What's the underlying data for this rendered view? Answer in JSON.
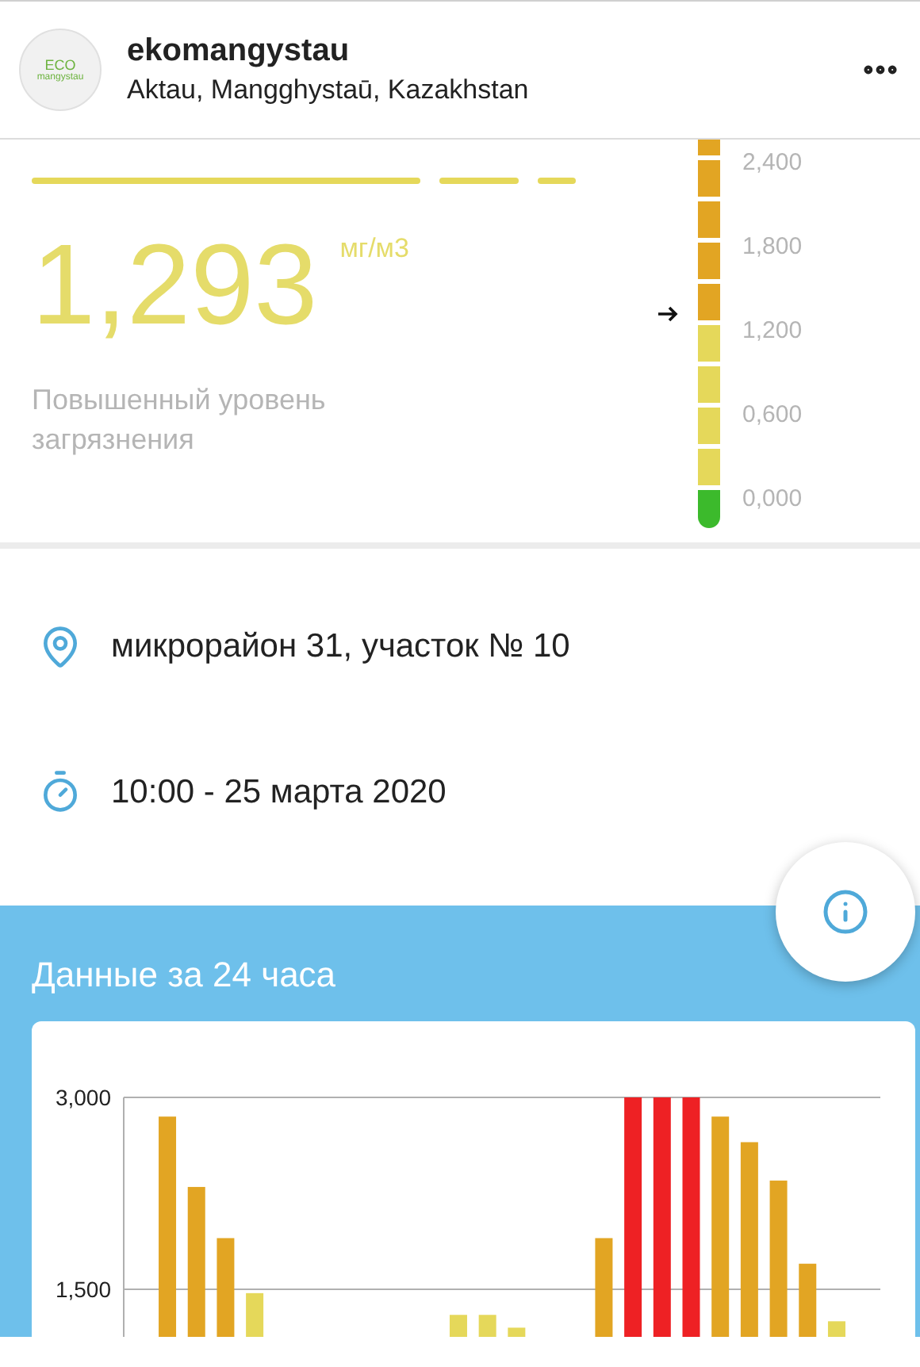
{
  "header": {
    "logo_text": [
      "ECO",
      "mangystau"
    ],
    "account": "ekomangystau",
    "location": "Aktau, Mangghystaū, Kazakhstan"
  },
  "reading": {
    "value": "1,293",
    "unit": "мг/м3",
    "status": "Повышенный уровень загрязнения",
    "scale_labels": [
      "2,400",
      "1,800",
      "1,200",
      "0,600",
      "0,000"
    ]
  },
  "details": [
    {
      "kind": "place",
      "text": "микрорайон 31, участок № 10"
    },
    {
      "kind": "time",
      "text": "10:00 - 25 марта 2020"
    }
  ],
  "history": {
    "title": "Данные за 24 часа",
    "chart_data": {
      "type": "bar",
      "ylim": [
        0,
        3
      ],
      "yticks": [
        {
          "value": 1.5,
          "label": "1,500"
        },
        {
          "value": 3,
          "label": "3,000"
        }
      ],
      "series": [
        {
          "color": "#ee2124",
          "values": [
            null,
            null,
            null,
            null,
            null,
            null,
            null,
            null,
            null,
            null,
            null,
            null,
            null,
            null,
            null,
            null,
            null,
            3,
            3,
            3,
            null,
            null,
            null,
            null,
            null,
            null
          ]
        },
        {
          "color": "#e2a523",
          "values": [
            null,
            2.85,
            2.3,
            1.9,
            null,
            null,
            null,
            null,
            null,
            null,
            null,
            null,
            null,
            null,
            null,
            null,
            1.9,
            null,
            null,
            null,
            2.85,
            2.65,
            2.35,
            1.7,
            null,
            null
          ]
        },
        {
          "color": "#e5d85a",
          "values": [
            null,
            null,
            null,
            null,
            1.47,
            null,
            null,
            null,
            null,
            null,
            null,
            1.3,
            1.3,
            1.2,
            null,
            null,
            null,
            null,
            null,
            null,
            null,
            null,
            null,
            null,
            1.25,
            null
          ]
        }
      ]
    }
  }
}
